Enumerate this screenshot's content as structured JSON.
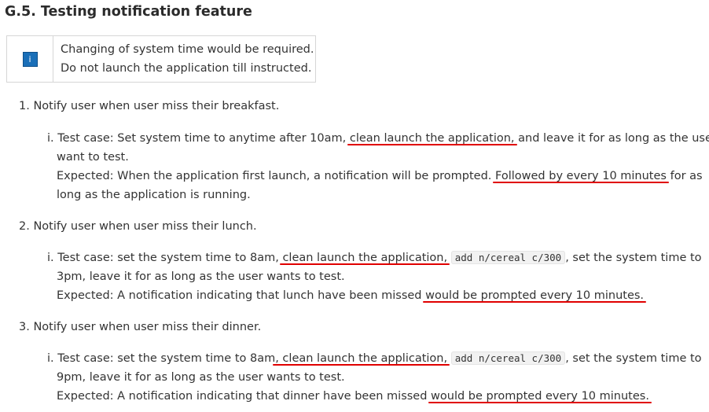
{
  "heading": "G.5. Testing notification feature",
  "info_box": {
    "icon": "info-icon",
    "icon_glyph": "i",
    "line1": "Changing of system time would be required.",
    "line2": "Do not launch the application till instructed."
  },
  "items": [
    {
      "title": "1. Notify user when user miss their breakfast.",
      "case_marker": "i.",
      "test_prefix": "Test case: Set system time to anytime after 10am, ",
      "test_highlight": "clean launch the application,",
      "test_suffix": " and leave it for as long as the user",
      "test_line2": "want to test.",
      "expected_prefix": "Expected: When the application first launch, a notification will be prompted. ",
      "expected_highlight": "Followed by every 10 minutes",
      "expected_suffix": " for as",
      "expected_line2": "long as the application is running."
    },
    {
      "title": "2. Notify user when user miss their lunch.",
      "case_marker": "i.",
      "test_prefix": "Test case: set the system time to 8am, ",
      "test_highlight": "clean launch the application,",
      "test_code": "add n/cereal c/300",
      "test_suffix": ", set the system time to",
      "test_line2": "3pm, leave it for as long as the user wants to test.",
      "expected_prefix": "Expected: A notification indicating that lunch have been missed ",
      "expected_highlight": "would be prompted every 10 minutes."
    },
    {
      "title": "3. Notify user when user miss their dinner.",
      "case_marker": "i.",
      "test_prefix": "Test case: set the system time to 8am",
      "test_highlight": ", clean launch the application,",
      "test_code": "add n/cereal c/300",
      "test_suffix": ", set the system time to",
      "test_line2": "9pm, leave it for as long as the user wants to test.",
      "expected_prefix": "Expected: A notification indicating that dinner have been missed ",
      "expected_highlight": "would be prompted every 10 minutes."
    }
  ],
  "colors": {
    "underline": "#e00000",
    "info_icon": "#1a6fb8",
    "text": "#333333"
  }
}
